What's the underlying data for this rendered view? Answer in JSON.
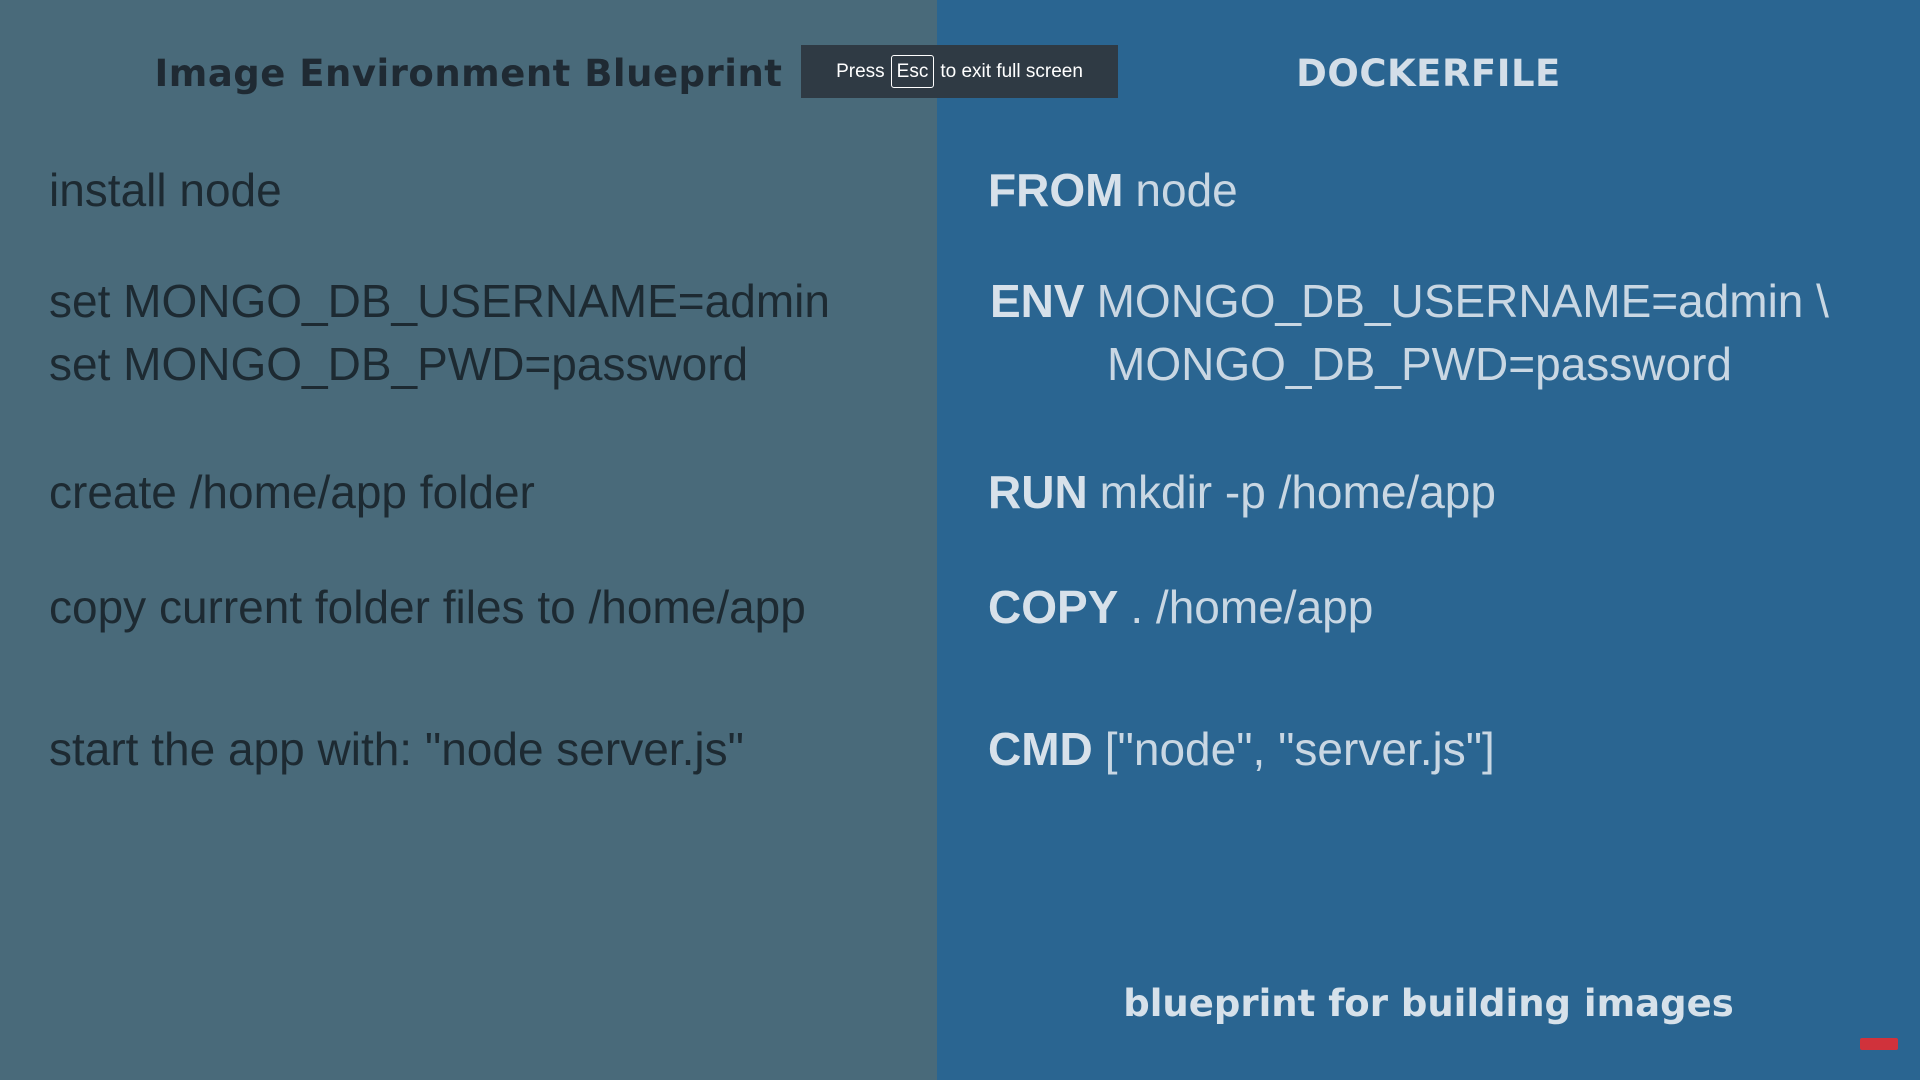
{
  "left": {
    "title": "Image Environment Blueprint",
    "lines": [
      "install node",
      "set MONGO_DB_USERNAME=admin",
      "set MONGO_DB_PWD=password",
      "create /home/app folder",
      "copy current folder files to /home/app",
      "start the app with: \"node server.js\""
    ]
  },
  "right": {
    "title": "DOCKERFILE",
    "lines": [
      {
        "kw": "FROM",
        "text": "node"
      },
      {
        "kw": "ENV",
        "text": "MONGO_DB_USERNAME=admin \\"
      },
      {
        "kw": "",
        "text": "MONGO_DB_PWD=password"
      },
      {
        "kw": "RUN",
        "text": "mkdir -p /home/app"
      },
      {
        "kw": "COPY",
        "text": ".  /home/app"
      },
      {
        "kw": "CMD",
        "text": "[\"node\", \"server.js\"]"
      }
    ],
    "footer": "blueprint for building images"
  },
  "overlay": {
    "press": "Press",
    "key": "Esc",
    "rest": "to exit full screen"
  },
  "colors": {
    "left_bg": "#496a7a",
    "right_bg": "#2a6591",
    "overlay_bg": "#2f3a44"
  }
}
